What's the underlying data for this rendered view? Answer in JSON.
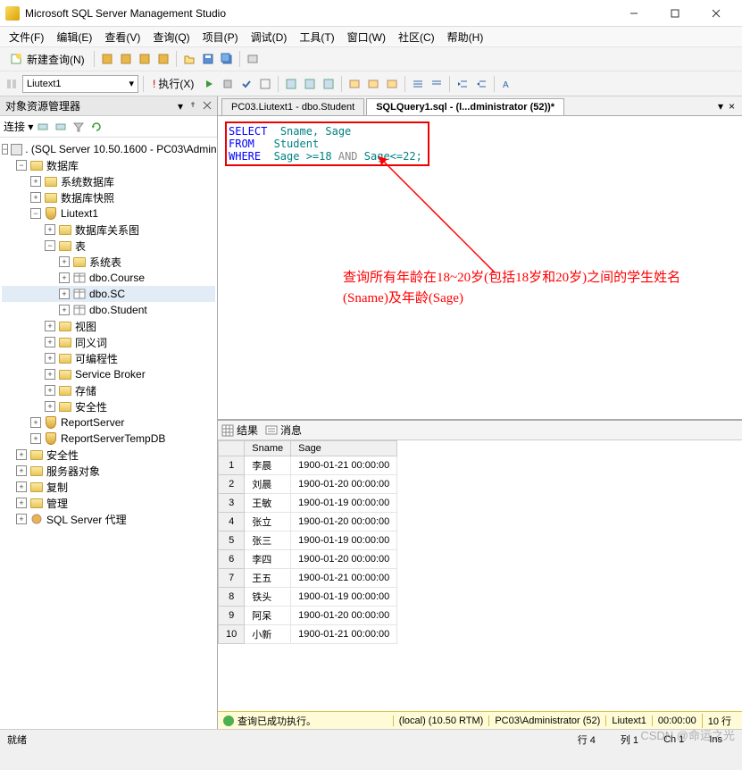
{
  "window": {
    "title": "Microsoft SQL Server Management Studio"
  },
  "menu": [
    "文件(F)",
    "编辑(E)",
    "查看(V)",
    "查询(Q)",
    "项目(P)",
    "调试(D)",
    "工具(T)",
    "窗口(W)",
    "社区(C)",
    "帮助(H)"
  ],
  "toolbar1": {
    "newquery": "新建查询(N)"
  },
  "toolbar2": {
    "db_combo": "Liutext1",
    "execute": "执行(X)"
  },
  "explorer": {
    "title": "对象资源管理器",
    "connect": "连接 ▾",
    "root": ". (SQL Server 10.50.1600 - PC03\\Administ",
    "nodes": {
      "databases": "数据库",
      "sysdb": "系统数据库",
      "snapshot": "数据库快照",
      "userdb": "Liutext1",
      "diagram": "数据库关系图",
      "tables": "表",
      "systables": "系统表",
      "t1": "dbo.Course",
      "t2": "dbo.SC",
      "t3": "dbo.Student",
      "views": "视图",
      "synonyms": "同义词",
      "prog": "可编程性",
      "sb": "Service Broker",
      "storage": "存储",
      "security": "安全性",
      "rs": "ReportServer",
      "rstmp": "ReportServerTempDB",
      "srv_security": "安全性",
      "srv_objects": "服务器对象",
      "replication": "复制",
      "management": "管理",
      "agent": "SQL Server 代理"
    }
  },
  "tabs": {
    "t1": "PC03.Liutext1 - dbo.Student",
    "t2": "SQLQuery1.sql - (l...dministrator (52))*"
  },
  "sql": {
    "l1a": "SELECT",
    "l1b": "Sname, Sage",
    "l2a": "FROM",
    "l2b": "Student",
    "l3a": "WHERE",
    "l3b": "Sage >=18",
    "l3c": "AND",
    "l3d": "Sage<=22;"
  },
  "annotation": "查询所有年龄在18~20岁(包括18岁和20岁)之间的学生姓名(Sname)及年龄(Sage)",
  "results": {
    "tab_results": "结果",
    "tab_messages": "消息",
    "columns": [
      "",
      "Sname",
      "Sage"
    ],
    "rows": [
      [
        "1",
        "李晨",
        "1900-01-21 00:00:00"
      ],
      [
        "2",
        "刘晨",
        "1900-01-20 00:00:00"
      ],
      [
        "3",
        "王敏",
        "1900-01-19 00:00:00"
      ],
      [
        "4",
        "张立",
        "1900-01-20 00:00:00"
      ],
      [
        "5",
        "张三",
        "1900-01-19 00:00:00"
      ],
      [
        "6",
        "李四",
        "1900-01-20 00:00:00"
      ],
      [
        "7",
        "王五",
        "1900-01-21 00:00:00"
      ],
      [
        "8",
        "铁头",
        "1900-01-19 00:00:00"
      ],
      [
        "9",
        "阿呆",
        "1900-01-20 00:00:00"
      ],
      [
        "10",
        "小新",
        "1900-01-21 00:00:00"
      ]
    ]
  },
  "query_status": {
    "msg": "查询已成功执行。",
    "server": "(local) (10.50 RTM)",
    "user": "PC03\\Administrator (52)",
    "db": "Liutext1",
    "time": "00:00:00",
    "rows": "10 行"
  },
  "statusbar": {
    "ready": "就绪",
    "line": "行 4",
    "col": "列 1",
    "ch": "Ch 1",
    "ins": "Ins"
  },
  "watermark": "CSDN @命运之光"
}
